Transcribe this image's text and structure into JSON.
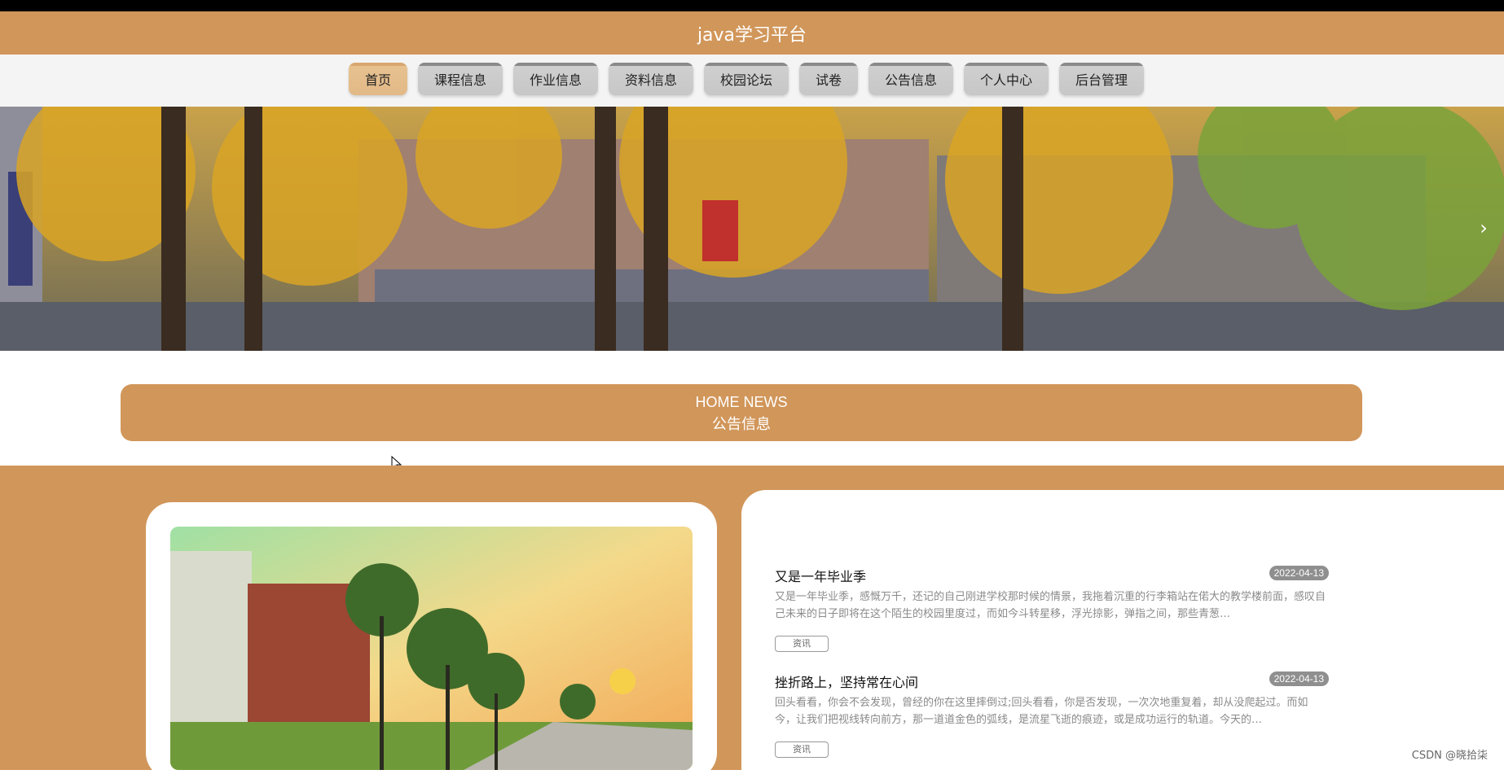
{
  "header": {
    "title": "java学习平台"
  },
  "nav": {
    "items": [
      {
        "label": "首页",
        "active": true
      },
      {
        "label": "课程信息",
        "active": false
      },
      {
        "label": "作业信息",
        "active": false
      },
      {
        "label": "资料信息",
        "active": false
      },
      {
        "label": "校园论坛",
        "active": false
      },
      {
        "label": "试卷",
        "active": false
      },
      {
        "label": "公告信息",
        "active": false
      },
      {
        "label": "个人中心",
        "active": false
      },
      {
        "label": "后台管理",
        "active": false
      }
    ]
  },
  "banner": {
    "next_icon": "chevron-right-icon"
  },
  "news_section": {
    "title_en": "HOME NEWS",
    "title_cn": "公告信息"
  },
  "news": [
    {
      "title": "又是一年毕业季",
      "date": "2022-04-13",
      "body": "又是一年毕业季，感慨万千，还记的自己刚进学校那时候的情景，我拖着沉重的行李箱站在偌大的教学楼前面，感叹自己未来的日子即将在这个陌生的校园里度过，而如今斗转星移，浮光掠影，弹指之间，那些青葱…",
      "tag": "资讯"
    },
    {
      "title": "挫折路上，坚持常在心间",
      "date": "2022-04-13",
      "body": "回头看看，你会不会发现，曾经的你在这里摔倒过;回头看看，你是否发现，一次次地重复着，却从没爬起过。而如今，让我们把视线转向前方，那一道道金色的弧线，是流星飞逝的痕迹，或是成功运行的轨道。今天的…",
      "tag": "资讯"
    }
  ],
  "watermark": "CSDN @晓拾柒",
  "colors": {
    "accent": "#d1965a",
    "nav_bg": "#f4f4f4"
  }
}
